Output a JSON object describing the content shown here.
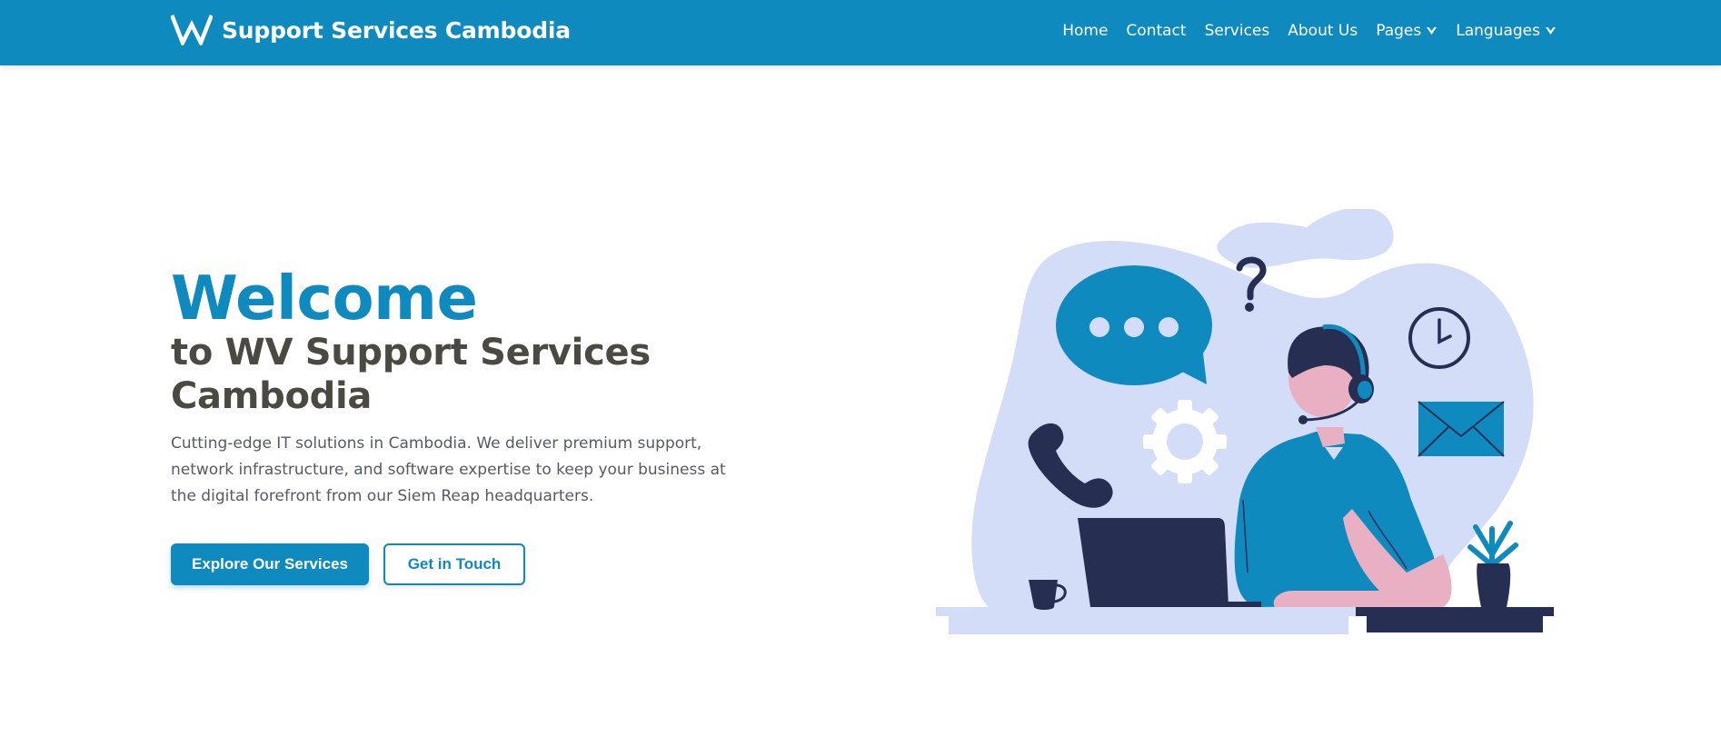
{
  "navbar": {
    "brand": "Support Services Cambodia",
    "logo_icon": "wv-logo-icon",
    "links": [
      {
        "label": "Home"
      },
      {
        "label": "Contact"
      },
      {
        "label": "Services"
      },
      {
        "label": "About Us"
      },
      {
        "label": "Pages",
        "dropdown": true
      },
      {
        "label": "Languages",
        "dropdown": true
      }
    ]
  },
  "hero": {
    "heading": "Welcome",
    "subheading": "to WV Support Services Cambodia",
    "description": "Cutting-edge IT solutions in Cambodia. We deliver premium support, network infrastructure, and software expertise to keep your business at the digital forefront from our Siem Reap headquarters.",
    "primary_button": "Explore Our Services",
    "secondary_button": "Get in Touch"
  },
  "illustration": {
    "icons": [
      "chat-bubble-icon",
      "question-mark-icon",
      "clock-icon",
      "envelope-icon",
      "phone-icon",
      "gear-icon",
      "laptop-icon",
      "coffee-cup-icon",
      "plant-icon",
      "headset-agent-icon"
    ]
  },
  "colors": {
    "primary": "#0f8abf",
    "heading_dark": "#4a4a42",
    "text": "#555a63",
    "blob": "#d4ddf7",
    "navy": "#262e52",
    "skin": "#e8b0c2"
  }
}
